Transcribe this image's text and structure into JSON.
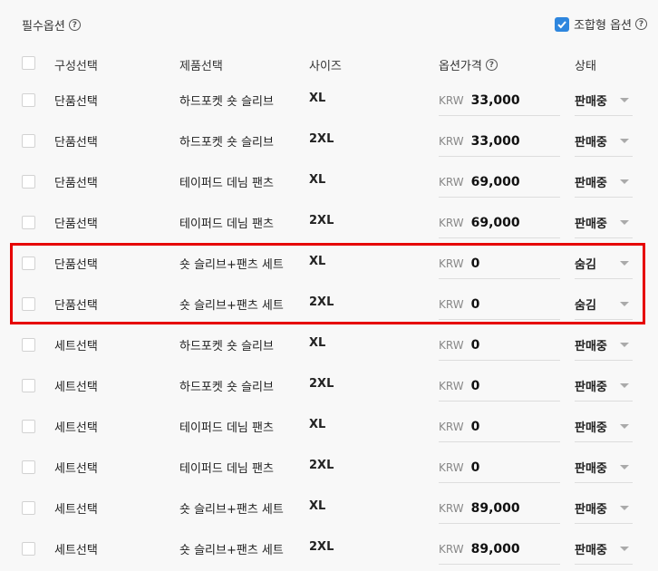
{
  "section": {
    "title": "필수옵션",
    "help": "?"
  },
  "combo": {
    "label": "조합형 옵션",
    "help": "?"
  },
  "columns": {
    "compose": "구성선택",
    "product": "제품선택",
    "size": "사이즈",
    "price": "옵션가격",
    "price_help": "?",
    "status": "상태"
  },
  "rows": [
    {
      "compose": "단품선택",
      "product": "하드포켓 숏 슬리브",
      "size": "XL",
      "currency": "KRW",
      "price": "33,000",
      "status": "판매중"
    },
    {
      "compose": "단품선택",
      "product": "하드포켓 숏 슬리브",
      "size": "2XL",
      "currency": "KRW",
      "price": "33,000",
      "status": "판매중"
    },
    {
      "compose": "단품선택",
      "product": "테이퍼드 데님 팬츠",
      "size": "XL",
      "currency": "KRW",
      "price": "69,000",
      "status": "판매중"
    },
    {
      "compose": "단품선택",
      "product": "테이퍼드 데님 팬츠",
      "size": "2XL",
      "currency": "KRW",
      "price": "69,000",
      "status": "판매중"
    },
    {
      "compose": "단품선택",
      "product": "숏 슬리브+팬츠 세트",
      "size": "XL",
      "currency": "KRW",
      "price": "0",
      "status": "숨김"
    },
    {
      "compose": "단품선택",
      "product": "숏 슬리브+팬츠 세트",
      "size": "2XL",
      "currency": "KRW",
      "price": "0",
      "status": "숨김"
    },
    {
      "compose": "세트선택",
      "product": "하드포켓 숏 슬리브",
      "size": "XL",
      "currency": "KRW",
      "price": "0",
      "status": "판매중"
    },
    {
      "compose": "세트선택",
      "product": "하드포켓 숏 슬리브",
      "size": "2XL",
      "currency": "KRW",
      "price": "0",
      "status": "판매중"
    },
    {
      "compose": "세트선택",
      "product": "테이퍼드 데님 팬츠",
      "size": "XL",
      "currency": "KRW",
      "price": "0",
      "status": "판매중"
    },
    {
      "compose": "세트선택",
      "product": "테이퍼드 데님 팬츠",
      "size": "2XL",
      "currency": "KRW",
      "price": "0",
      "status": "판매중"
    },
    {
      "compose": "세트선택",
      "product": "숏 슬리브+팬츠 세트",
      "size": "XL",
      "currency": "KRW",
      "price": "89,000",
      "status": "판매중"
    },
    {
      "compose": "세트선택",
      "product": "숏 슬리브+팬츠 세트",
      "size": "2XL",
      "currency": "KRW",
      "price": "89,000",
      "status": "판매중"
    }
  ],
  "colors": {
    "accent": "#2e86de",
    "highlight": "#e60000"
  }
}
